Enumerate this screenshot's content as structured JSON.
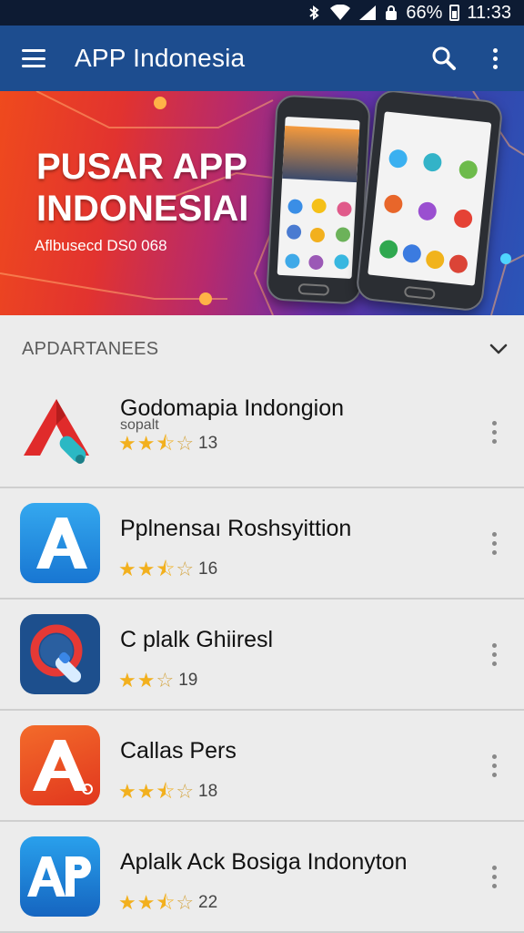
{
  "status_bar": {
    "battery": "66%",
    "time": "11:33"
  },
  "app_bar": {
    "title": "APP Indonesia"
  },
  "banner": {
    "title_line1": "PUSAR APP",
    "title_line2": "INDONESIAI",
    "subtitle": "Aflbusecd DS0 068"
  },
  "section": {
    "label": "APDARTANEES"
  },
  "apps": [
    {
      "name": "Godomapia Indongion",
      "subtitle": "sopalt",
      "rating": 2.5,
      "count": "13"
    },
    {
      "name": "Pplnensаı Roshsyittion",
      "subtitle": "",
      "rating": 2.5,
      "count": "16"
    },
    {
      "name": "C plalk Ghiiresl",
      "subtitle": "",
      "rating": 2,
      "count": "19"
    },
    {
      "name": "Callas Pers",
      "subtitle": "",
      "rating": 2.5,
      "count": "18"
    },
    {
      "name": "Aplalk Ack Bosiga Indonyton",
      "subtitle": "",
      "rating": 2.5,
      "count": "22"
    }
  ],
  "icons": {
    "menu": "hamburger-icon",
    "search": "search-icon",
    "more": "more-vert-icon",
    "expand": "chevron-down-icon",
    "wifi": "wifi-icon",
    "signal": "signal-icon",
    "battery": "battery-icon",
    "bluetooth": "bluetooth-icon",
    "lock": "lock-icon"
  },
  "colors": {
    "app_bar": "#1d4d8f",
    "status_bar": "#0d1b33",
    "star": "#f2b01e"
  }
}
